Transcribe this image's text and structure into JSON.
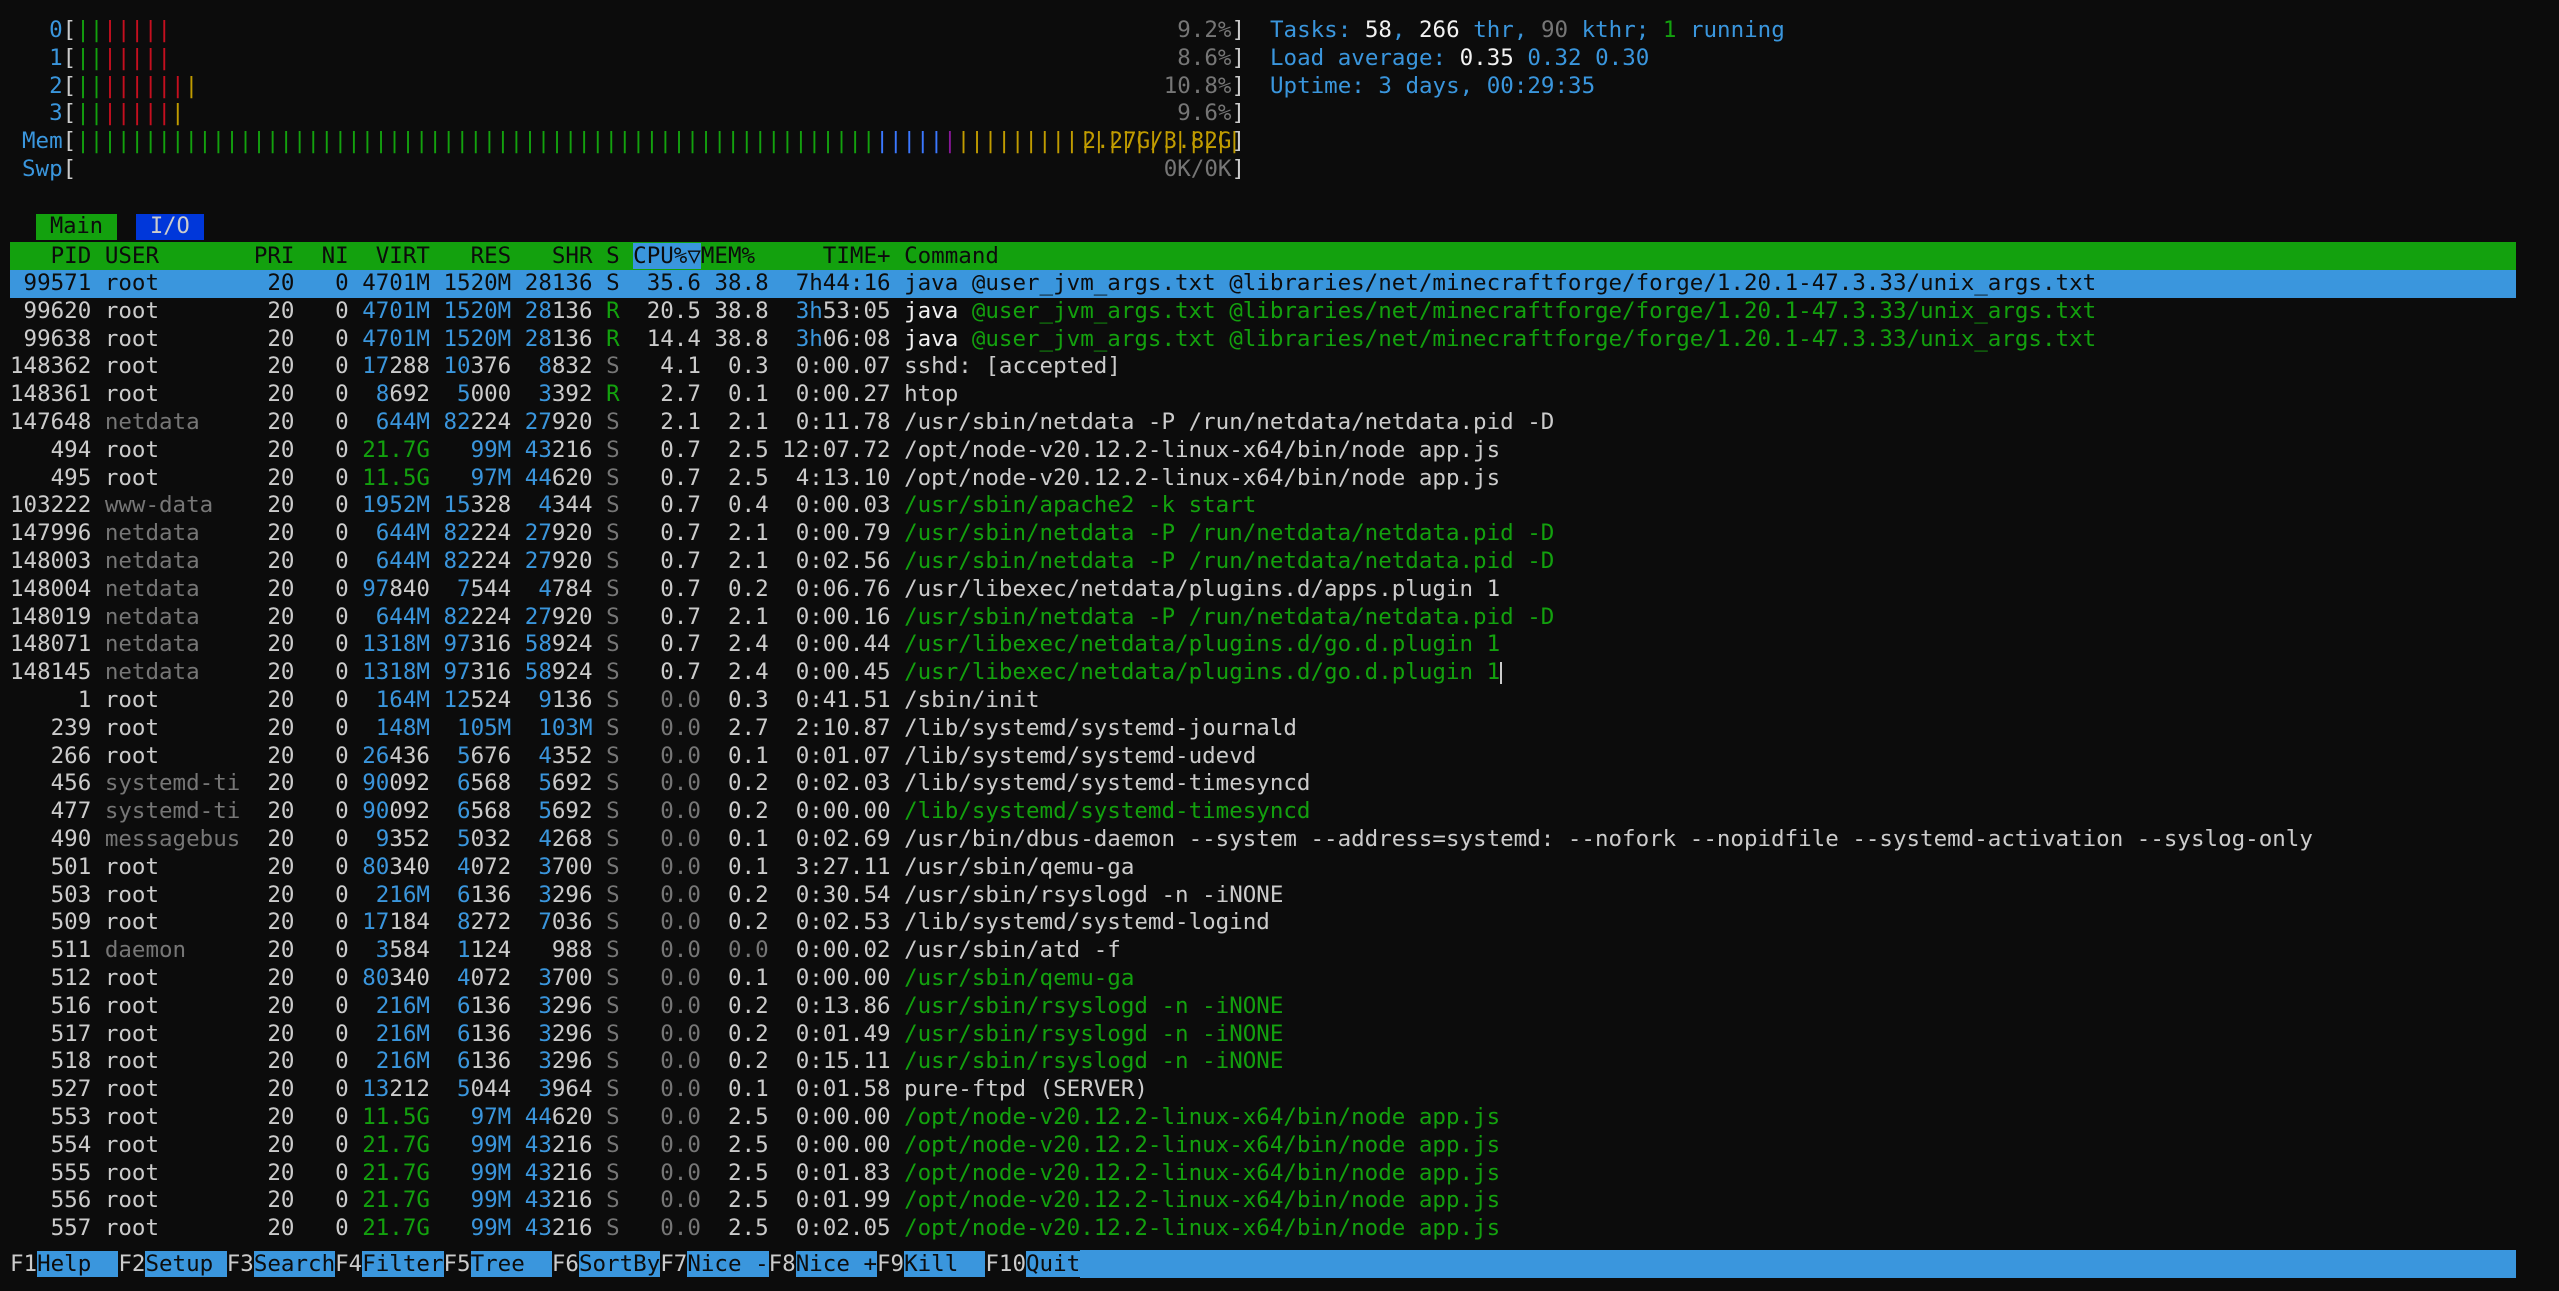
{
  "meters": {
    "cpu": [
      {
        "label": "0",
        "bars": [
          [
            "g",
            "||"
          ],
          [
            "r",
            "|||||"
          ]
        ],
        "value": "9.2%"
      },
      {
        "label": "1",
        "bars": [
          [
            "g",
            "||"
          ],
          [
            "r",
            "|||||"
          ]
        ],
        "value": "8.6%"
      },
      {
        "label": "2",
        "bars": [
          [
            "g",
            "||"
          ],
          [
            "r",
            "||||||"
          ],
          [
            "y",
            "|"
          ]
        ],
        "value": "10.8%"
      },
      {
        "label": "3",
        "bars": [
          [
            "g",
            "||"
          ],
          [
            "r",
            "|||||"
          ],
          [
            "y",
            "|"
          ]
        ],
        "value": "9.6%"
      }
    ],
    "mem": {
      "label": "Mem",
      "bars": [
        [
          "g",
          "|||||||||||||||||||||||||||||||||||||||||||||||||||||||||||"
        ],
        [
          "b",
          "|||||"
        ],
        [
          "m",
          "|"
        ],
        [
          "y",
          "|||||||||||||||||||||"
        ]
      ],
      "value": "2.27G/3.82G"
    },
    "swp": {
      "label": "Swp",
      "value": "0K/0K"
    }
  },
  "summary": {
    "tasks_label": "Tasks:",
    "tasks": "58",
    "thr": "266",
    "thr_label": "thr,",
    "kthr": "90",
    "kthr_label": "kthr;",
    "running": "1",
    "running_label": "running",
    "load_label": "Load average:",
    "load1": "0.35",
    "load5": "0.32",
    "load15": "0.30",
    "uptime_label": "Uptime:",
    "uptime": "3 days, 00:29:35"
  },
  "tabs": {
    "main": "Main",
    "io": "I/O"
  },
  "columns": {
    "pid": "PID",
    "user": "USER",
    "pri": "PRI",
    "ni": "NI",
    "virt": "VIRT",
    "res": "RES",
    "shr": "SHR",
    "s": "S",
    "cpu": "CPU%▽",
    "mem": "MEM%",
    "time": "TIME+",
    "command": "Command"
  },
  "processes": [
    {
      "pid": "99571",
      "user": "root",
      "pri": "20",
      "ni": "0",
      "virt": "4701M",
      "res": "1520M",
      "shr": "28136",
      "s": "S",
      "cpu": "35.6",
      "mem": "38.8",
      "time": "7h44:16",
      "cmd_bin": "java",
      "cmd_args": " @user_jvm_args.txt @libraries/net/minecraftforge/forge/1.20.1-47.3.33/unix_args.txt",
      "thread": false,
      "selected": true
    },
    {
      "pid": "99620",
      "user": "root",
      "pri": "20",
      "ni": "0",
      "virt": "4701M",
      "res": "1520M",
      "shr": "28136",
      "s": "R",
      "cpu": "20.5",
      "mem": "38.8",
      "time": "3h53:05",
      "cmd_bin": "java",
      "cmd_args": " @user_jvm_args.txt @libraries/net/minecraftforge/forge/1.20.1-47.3.33/unix_args.txt",
      "thread": true,
      "selected": false
    },
    {
      "pid": "99638",
      "user": "root",
      "pri": "20",
      "ni": "0",
      "virt": "4701M",
      "res": "1520M",
      "shr": "28136",
      "s": "R",
      "cpu": "14.4",
      "mem": "38.8",
      "time": "3h06:08",
      "cmd_bin": "java",
      "cmd_args": " @user_jvm_args.txt @libraries/net/minecraftforge/forge/1.20.1-47.3.33/unix_args.txt",
      "thread": true,
      "selected": false
    },
    {
      "pid": "148362",
      "user": "root",
      "pri": "20",
      "ni": "0",
      "virt": "17288",
      "res": "10376",
      "shr": "8832",
      "s": "S",
      "cpu": "4.1",
      "mem": "0.3",
      "time": "0:00.07",
      "cmd_bin": "",
      "cmd_args": "sshd: [accepted]",
      "thread": false,
      "selected": false
    },
    {
      "pid": "148361",
      "user": "root",
      "pri": "20",
      "ni": "0",
      "virt": "8692",
      "res": "5000",
      "shr": "3392",
      "s": "R",
      "cpu": "2.7",
      "mem": "0.1",
      "time": "0:00.27",
      "cmd_bin": "",
      "cmd_args": "htop",
      "thread": false,
      "selected": false
    },
    {
      "pid": "147648",
      "user": "netdata",
      "pri": "20",
      "ni": "0",
      "virt": "644M",
      "res": "82224",
      "shr": "27920",
      "s": "S",
      "cpu": "2.1",
      "mem": "2.1",
      "time": "0:11.78",
      "cmd_bin": "",
      "cmd_args": "/usr/sbin/netdata -P /run/netdata/netdata.pid -D",
      "thread": false,
      "selected": false
    },
    {
      "pid": "494",
      "user": "root",
      "pri": "20",
      "ni": "0",
      "virt": "21.7G",
      "res": "99M",
      "shr": "43216",
      "s": "S",
      "cpu": "0.7",
      "mem": "2.5",
      "time": "12:07.72",
      "cmd_bin": "",
      "cmd_args": "/opt/node-v20.12.2-linux-x64/bin/node app.js",
      "thread": false,
      "selected": false
    },
    {
      "pid": "495",
      "user": "root",
      "pri": "20",
      "ni": "0",
      "virt": "11.5G",
      "res": "97M",
      "shr": "44620",
      "s": "S",
      "cpu": "0.7",
      "mem": "2.5",
      "time": "4:13.10",
      "cmd_bin": "",
      "cmd_args": "/opt/node-v20.12.2-linux-x64/bin/node app.js",
      "thread": false,
      "selected": false
    },
    {
      "pid": "103222",
      "user": "www-data",
      "pri": "20",
      "ni": "0",
      "virt": "1952M",
      "res": "15328",
      "shr": "4344",
      "s": "S",
      "cpu": "0.7",
      "mem": "0.4",
      "time": "0:00.03",
      "cmd_bin": "",
      "cmd_args": "/usr/sbin/apache2 -k start",
      "thread": true,
      "selected": false
    },
    {
      "pid": "147996",
      "user": "netdata",
      "pri": "20",
      "ni": "0",
      "virt": "644M",
      "res": "82224",
      "shr": "27920",
      "s": "S",
      "cpu": "0.7",
      "mem": "2.1",
      "time": "0:00.79",
      "cmd_bin": "",
      "cmd_args": "/usr/sbin/netdata -P /run/netdata/netdata.pid -D",
      "thread": true,
      "selected": false
    },
    {
      "pid": "148003",
      "user": "netdata",
      "pri": "20",
      "ni": "0",
      "virt": "644M",
      "res": "82224",
      "shr": "27920",
      "s": "S",
      "cpu": "0.7",
      "mem": "2.1",
      "time": "0:02.56",
      "cmd_bin": "",
      "cmd_args": "/usr/sbin/netdata -P /run/netdata/netdata.pid -D",
      "thread": true,
      "selected": false
    },
    {
      "pid": "148004",
      "user": "netdata",
      "pri": "20",
      "ni": "0",
      "virt": "97840",
      "res": "7544",
      "shr": "4784",
      "s": "S",
      "cpu": "0.7",
      "mem": "0.2",
      "time": "0:06.76",
      "cmd_bin": "",
      "cmd_args": "/usr/libexec/netdata/plugins.d/apps.plugin 1",
      "thread": false,
      "selected": false
    },
    {
      "pid": "148019",
      "user": "netdata",
      "pri": "20",
      "ni": "0",
      "virt": "644M",
      "res": "82224",
      "shr": "27920",
      "s": "S",
      "cpu": "0.7",
      "mem": "2.1",
      "time": "0:00.16",
      "cmd_bin": "",
      "cmd_args": "/usr/sbin/netdata -P /run/netdata/netdata.pid -D",
      "thread": true,
      "selected": false
    },
    {
      "pid": "148071",
      "user": "netdata",
      "pri": "20",
      "ni": "0",
      "virt": "1318M",
      "res": "97316",
      "shr": "58924",
      "s": "S",
      "cpu": "0.7",
      "mem": "2.4",
      "time": "0:00.44",
      "cmd_bin": "",
      "cmd_args": "/usr/libexec/netdata/plugins.d/go.d.plugin 1",
      "thread": true,
      "selected": false
    },
    {
      "pid": "148145",
      "user": "netdata",
      "pri": "20",
      "ni": "0",
      "virt": "1318M",
      "res": "97316",
      "shr": "58924",
      "s": "S",
      "cpu": "0.7",
      "mem": "2.4",
      "time": "0:00.45",
      "cmd_bin": "",
      "cmd_args": "/usr/libexec/netdata/plugins.d/go.d.plugin 1",
      "thread": true,
      "selected": false,
      "cursor": true
    },
    {
      "pid": "1",
      "user": "root",
      "pri": "20",
      "ni": "0",
      "virt": "164M",
      "res": "12524",
      "shr": "9136",
      "s": "S",
      "cpu": "0.0",
      "mem": "0.3",
      "time": "0:41.51",
      "cmd_bin": "",
      "cmd_args": "/sbin/init",
      "thread": false,
      "selected": false
    },
    {
      "pid": "239",
      "user": "root",
      "pri": "20",
      "ni": "0",
      "virt": "148M",
      "res": "105M",
      "shr": "103M",
      "s": "S",
      "cpu": "0.0",
      "mem": "2.7",
      "time": "2:10.87",
      "cmd_bin": "",
      "cmd_args": "/lib/systemd/systemd-journald",
      "thread": false,
      "selected": false
    },
    {
      "pid": "266",
      "user": "root",
      "pri": "20",
      "ni": "0",
      "virt": "26436",
      "res": "5676",
      "shr": "4352",
      "s": "S",
      "cpu": "0.0",
      "mem": "0.1",
      "time": "0:01.07",
      "cmd_bin": "",
      "cmd_args": "/lib/systemd/systemd-udevd",
      "thread": false,
      "selected": false
    },
    {
      "pid": "456",
      "user": "systemd-ti",
      "pri": "20",
      "ni": "0",
      "virt": "90092",
      "res": "6568",
      "shr": "5692",
      "s": "S",
      "cpu": "0.0",
      "mem": "0.2",
      "time": "0:02.03",
      "cmd_bin": "",
      "cmd_args": "/lib/systemd/systemd-timesyncd",
      "thread": false,
      "selected": false
    },
    {
      "pid": "477",
      "user": "systemd-ti",
      "pri": "20",
      "ni": "0",
      "virt": "90092",
      "res": "6568",
      "shr": "5692",
      "s": "S",
      "cpu": "0.0",
      "mem": "0.2",
      "time": "0:00.00",
      "cmd_bin": "",
      "cmd_args": "/lib/systemd/systemd-timesyncd",
      "thread": true,
      "selected": false
    },
    {
      "pid": "490",
      "user": "messagebus",
      "pri": "20",
      "ni": "0",
      "virt": "9352",
      "res": "5032",
      "shr": "4268",
      "s": "S",
      "cpu": "0.0",
      "mem": "0.1",
      "time": "0:02.69",
      "cmd_bin": "",
      "cmd_args": "/usr/bin/dbus-daemon --system --address=systemd: --nofork --nopidfile --systemd-activation --syslog-only",
      "thread": false,
      "selected": false
    },
    {
      "pid": "501",
      "user": "root",
      "pri": "20",
      "ni": "0",
      "virt": "80340",
      "res": "4072",
      "shr": "3700",
      "s": "S",
      "cpu": "0.0",
      "mem": "0.1",
      "time": "3:27.11",
      "cmd_bin": "",
      "cmd_args": "/usr/sbin/qemu-ga",
      "thread": false,
      "selected": false
    },
    {
      "pid": "503",
      "user": "root",
      "pri": "20",
      "ni": "0",
      "virt": "216M",
      "res": "6136",
      "shr": "3296",
      "s": "S",
      "cpu": "0.0",
      "mem": "0.2",
      "time": "0:30.54",
      "cmd_bin": "",
      "cmd_args": "/usr/sbin/rsyslogd -n -iNONE",
      "thread": false,
      "selected": false
    },
    {
      "pid": "509",
      "user": "root",
      "pri": "20",
      "ni": "0",
      "virt": "17184",
      "res": "8272",
      "shr": "7036",
      "s": "S",
      "cpu": "0.0",
      "mem": "0.2",
      "time": "0:02.53",
      "cmd_bin": "",
      "cmd_args": "/lib/systemd/systemd-logind",
      "thread": false,
      "selected": false
    },
    {
      "pid": "511",
      "user": "daemon",
      "pri": "20",
      "ni": "0",
      "virt": "3584",
      "res": "1124",
      "shr": "988",
      "s": "S",
      "cpu": "0.0",
      "mem": "0.0",
      "time": "0:00.02",
      "cmd_bin": "",
      "cmd_args": "/usr/sbin/atd -f",
      "thread": false,
      "selected": false
    },
    {
      "pid": "512",
      "user": "root",
      "pri": "20",
      "ni": "0",
      "virt": "80340",
      "res": "4072",
      "shr": "3700",
      "s": "S",
      "cpu": "0.0",
      "mem": "0.1",
      "time": "0:00.00",
      "cmd_bin": "",
      "cmd_args": "/usr/sbin/qemu-ga",
      "thread": true,
      "selected": false
    },
    {
      "pid": "516",
      "user": "root",
      "pri": "20",
      "ni": "0",
      "virt": "216M",
      "res": "6136",
      "shr": "3296",
      "s": "S",
      "cpu": "0.0",
      "mem": "0.2",
      "time": "0:13.86",
      "cmd_bin": "",
      "cmd_args": "/usr/sbin/rsyslogd -n -iNONE",
      "thread": true,
      "selected": false
    },
    {
      "pid": "517",
      "user": "root",
      "pri": "20",
      "ni": "0",
      "virt": "216M",
      "res": "6136",
      "shr": "3296",
      "s": "S",
      "cpu": "0.0",
      "mem": "0.2",
      "time": "0:01.49",
      "cmd_bin": "",
      "cmd_args": "/usr/sbin/rsyslogd -n -iNONE",
      "thread": true,
      "selected": false
    },
    {
      "pid": "518",
      "user": "root",
      "pri": "20",
      "ni": "0",
      "virt": "216M",
      "res": "6136",
      "shr": "3296",
      "s": "S",
      "cpu": "0.0",
      "mem": "0.2",
      "time": "0:15.11",
      "cmd_bin": "",
      "cmd_args": "/usr/sbin/rsyslogd -n -iNONE",
      "thread": true,
      "selected": false
    },
    {
      "pid": "527",
      "user": "root",
      "pri": "20",
      "ni": "0",
      "virt": "13212",
      "res": "5044",
      "shr": "3964",
      "s": "S",
      "cpu": "0.0",
      "mem": "0.1",
      "time": "0:01.58",
      "cmd_bin": "",
      "cmd_args": "pure-ftpd (SERVER)",
      "thread": false,
      "selected": false
    },
    {
      "pid": "553",
      "user": "root",
      "pri": "20",
      "ni": "0",
      "virt": "11.5G",
      "res": "97M",
      "shr": "44620",
      "s": "S",
      "cpu": "0.0",
      "mem": "2.5",
      "time": "0:00.00",
      "cmd_bin": "",
      "cmd_args": "/opt/node-v20.12.2-linux-x64/bin/node app.js",
      "thread": true,
      "selected": false
    },
    {
      "pid": "554",
      "user": "root",
      "pri": "20",
      "ni": "0",
      "virt": "21.7G",
      "res": "99M",
      "shr": "43216",
      "s": "S",
      "cpu": "0.0",
      "mem": "2.5",
      "time": "0:00.00",
      "cmd_bin": "",
      "cmd_args": "/opt/node-v20.12.2-linux-x64/bin/node app.js",
      "thread": true,
      "selected": false
    },
    {
      "pid": "555",
      "user": "root",
      "pri": "20",
      "ni": "0",
      "virt": "21.7G",
      "res": "99M",
      "shr": "43216",
      "s": "S",
      "cpu": "0.0",
      "mem": "2.5",
      "time": "0:01.83",
      "cmd_bin": "",
      "cmd_args": "/opt/node-v20.12.2-linux-x64/bin/node app.js",
      "thread": true,
      "selected": false
    },
    {
      "pid": "556",
      "user": "root",
      "pri": "20",
      "ni": "0",
      "virt": "21.7G",
      "res": "99M",
      "shr": "43216",
      "s": "S",
      "cpu": "0.0",
      "mem": "2.5",
      "time": "0:01.99",
      "cmd_bin": "",
      "cmd_args": "/opt/node-v20.12.2-linux-x64/bin/node app.js",
      "thread": true,
      "selected": false
    },
    {
      "pid": "557",
      "user": "root",
      "pri": "20",
      "ni": "0",
      "virt": "21.7G",
      "res": "99M",
      "shr": "43216",
      "s": "S",
      "cpu": "0.0",
      "mem": "2.5",
      "time": "0:02.05",
      "cmd_bin": "",
      "cmd_args": "/opt/node-v20.12.2-linux-x64/bin/node app.js",
      "thread": true,
      "selected": false
    }
  ],
  "footer": [
    {
      "key": "F1",
      "label": "Help  "
    },
    {
      "key": "F2",
      "label": "Setup "
    },
    {
      "key": "F3",
      "label": "Search"
    },
    {
      "key": "F4",
      "label": "Filter"
    },
    {
      "key": "F5",
      "label": "Tree  "
    },
    {
      "key": "F6",
      "label": "SortBy"
    },
    {
      "key": "F7",
      "label": "Nice -"
    },
    {
      "key": "F8",
      "label": "Nice +"
    },
    {
      "key": "F9",
      "label": "Kill  "
    },
    {
      "key": "F10",
      "label": "Quit"
    }
  ]
}
